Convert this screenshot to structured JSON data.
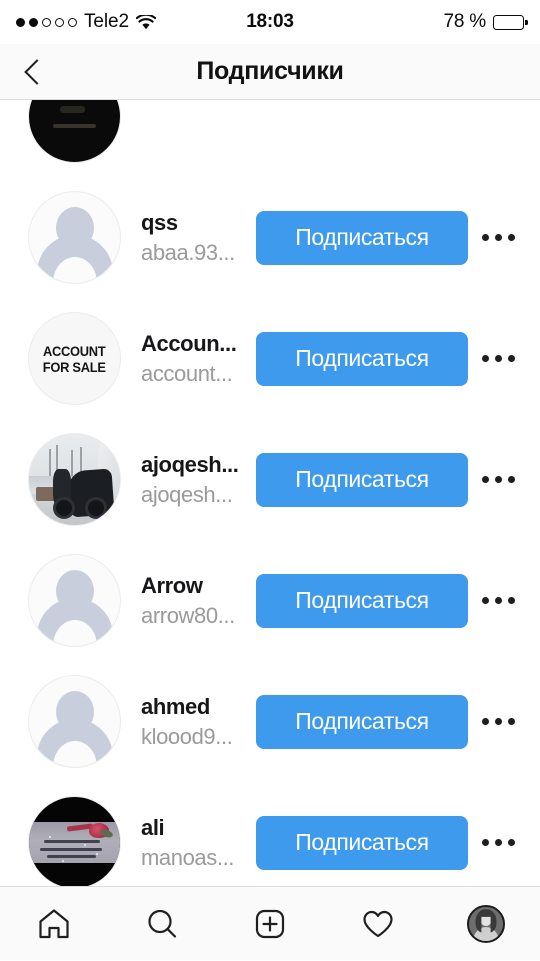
{
  "status_bar": {
    "carrier": "Tele2",
    "signal_dots_total": 5,
    "signal_dots_filled": 2,
    "wifi_icon": "wifi-icon",
    "time": "18:03",
    "battery_percent_label": "78 %",
    "battery_level": 78
  },
  "header": {
    "back_icon": "chevron-left-icon",
    "title": "Подписчики"
  },
  "list": {
    "clipped_top_row": {
      "avatar_type": "photo-dark",
      "avatar_name": "avatar-dark-clipped"
    },
    "rows": [
      {
        "avatar_type": "default-person",
        "full_name": "qss",
        "username": "abaa.93...",
        "follow_label": "Подписаться",
        "more_icon": "more-horizontal-icon"
      },
      {
        "avatar_type": "account-for-sale",
        "avatar_text_line1": "ACCOUNT",
        "avatar_text_line2": "FOR SALE",
        "full_name": "Accoun...",
        "username": "account...",
        "follow_label": "Подписаться",
        "more_icon": "more-horizontal-icon"
      },
      {
        "avatar_type": "photo-scooter",
        "full_name": "ajoqesh...",
        "username": "ajoqesh...",
        "follow_label": "Подписаться",
        "more_icon": "more-horizontal-icon"
      },
      {
        "avatar_type": "default-person",
        "full_name": "Arrow",
        "username": "arrow80...",
        "follow_label": "Подписаться",
        "more_icon": "more-horizontal-icon"
      },
      {
        "avatar_type": "default-person",
        "full_name": "ahmed",
        "username": "kloood9...",
        "follow_label": "Подписаться",
        "more_icon": "more-horizontal-icon"
      },
      {
        "avatar_type": "photo-ali",
        "full_name": "ali",
        "username": "manoas...",
        "follow_label": "Подписаться",
        "more_icon": "more-horizontal-icon"
      }
    ]
  },
  "tab_bar": {
    "items": [
      {
        "icon": "home-icon",
        "selected": false
      },
      {
        "icon": "search-icon",
        "selected": false
      },
      {
        "icon": "add-post-icon",
        "selected": false
      },
      {
        "icon": "heart-icon",
        "selected": false
      },
      {
        "icon": "profile-avatar-icon",
        "selected": true
      }
    ]
  },
  "colors": {
    "follow_button": "#3d9aed",
    "follow_button_text": "#ffffff",
    "header_background": "#fafafa",
    "full_name_text": "#17171a",
    "username_text": "#9a9a9a",
    "divider": "#dcdcdc"
  }
}
